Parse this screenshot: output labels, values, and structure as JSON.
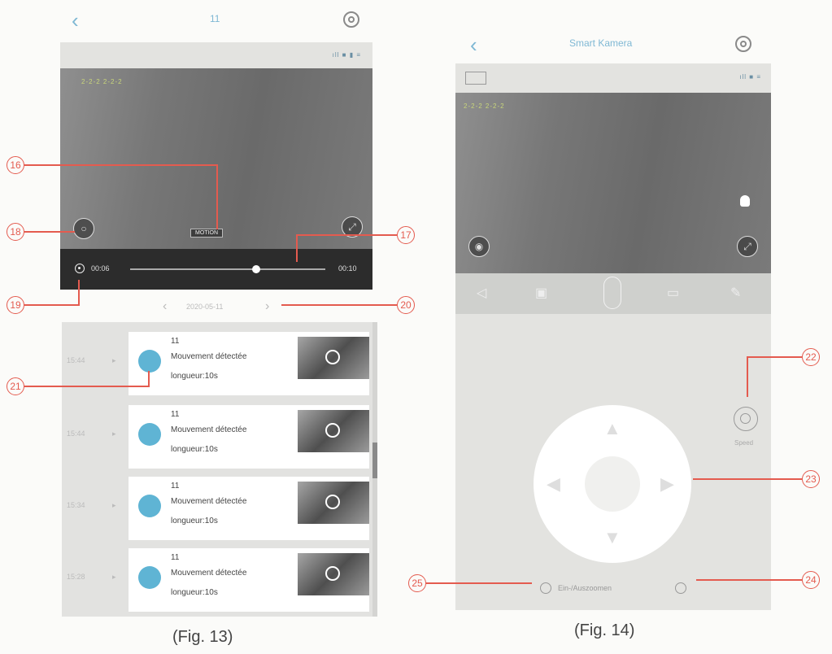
{
  "fig13": {
    "header": {
      "title": "11"
    },
    "status_icons": "ıll ■ ▮ ≡",
    "video": {
      "timestamp_overlay": "2-2-2 2-2-2",
      "motion_label": "MOTION"
    },
    "playback": {
      "current_time": "00:06",
      "end_time": "00:10"
    },
    "date_nav": {
      "date": "2020-05-11"
    },
    "events": [
      {
        "time": "15:44",
        "name": "11",
        "description": "Mouvement détectée",
        "length": "longueur:10s"
      },
      {
        "time": "15:44",
        "name": "11",
        "description": "Mouvement détectée",
        "length": "longueur:10s"
      },
      {
        "time": "15:34",
        "name": "11",
        "description": "Mouvement détectée",
        "length": "longueur:10s"
      },
      {
        "time": "15:28",
        "name": "11",
        "description": "Mouvement détectée",
        "length": "longueur:10s"
      }
    ],
    "caption": "(Fig. 13)"
  },
  "fig14": {
    "header": {
      "title": "Smart Kamera"
    },
    "status_icons": "ıll ■ ≡",
    "video": {
      "timestamp_overlay": "2-2-2 2-2-2"
    },
    "speed_label": "Speed",
    "zoom_label": "Ein-/Auszoomen",
    "caption": "(Fig. 14)"
  },
  "callouts": {
    "c16": "16",
    "c17": "17",
    "c18": "18",
    "c19": "19",
    "c20": "20",
    "c21": "21",
    "c22": "22",
    "c23": "23",
    "c24": "24",
    "c25": "25"
  },
  "colors": {
    "accent": "#7fb8d4",
    "callout": "#e45b4f",
    "avatar": "#5fb4d4"
  },
  "icons": [
    "chevron-left-icon",
    "gear-icon",
    "signal-icon",
    "battery-icon",
    "record-icon",
    "fullscreen-icon",
    "play-icon",
    "chevron-right-icon",
    "lamp-icon",
    "speaker-icon",
    "camera-icon",
    "mic-icon",
    "video-icon",
    "brush-icon",
    "speed-icon",
    "zoom-in-icon",
    "zoom-out-icon",
    "arrow-up-icon",
    "arrow-down-icon",
    "arrow-left-icon",
    "arrow-right-icon"
  ]
}
